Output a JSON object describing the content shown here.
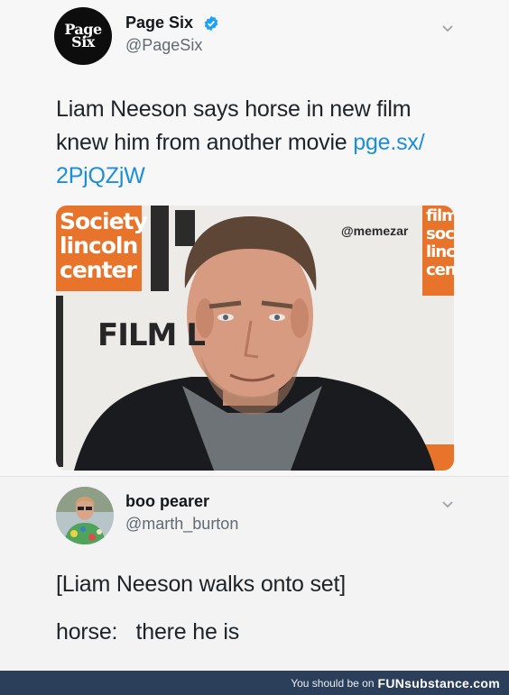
{
  "tweet1": {
    "display_name": "Page Six",
    "handle": "@PageSix",
    "avatar_logo": [
      "Page",
      "Six"
    ],
    "text_lines": [
      "Liam Neeson says horse in new film",
      "knew him from another movie "
    ],
    "link_part1": "pge.sx/",
    "link_part2": "2PjQZjW",
    "image": {
      "watermark": "@memezar",
      "backdrop_left": [
        "Society",
        "lincoln",
        "center"
      ],
      "backdrop_right": [
        "film",
        "soc",
        "linc",
        "cen"
      ],
      "backdrop_film": "FILM L"
    }
  },
  "tweet2": {
    "display_name": "boo pearer",
    "handle": "@marth_burton",
    "line1": "[Liam Neeson walks onto set]",
    "line2": "horse:   there he is"
  },
  "footer": {
    "prefix": "You should be on",
    "brand": "FUNsubstance.com"
  },
  "colors": {
    "link": "#1d8fd6",
    "verified": "#1da1f2",
    "footer_bg": "#2b3f5a",
    "backdrop_orange": "#e8742c"
  }
}
